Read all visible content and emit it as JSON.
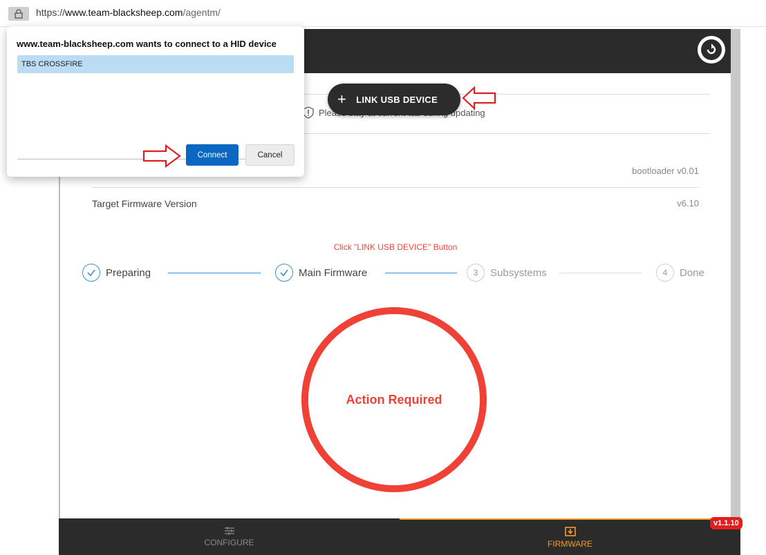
{
  "browser": {
    "url_prefix": "https://",
    "url_domain": "www.team-blacksheep.com",
    "url_path": "/agentm/"
  },
  "dialog": {
    "title": "www.team-blacksheep.com wants to connect to a HID device",
    "devices": [
      "TBS CROSSFIRE"
    ],
    "connect_label": "Connect",
    "cancel_label": "Cancel"
  },
  "link_button": {
    "label": "LINK USB DEVICE"
  },
  "notice": {
    "text": "Please stay at current tab during updating"
  },
  "firmware": {
    "current_value": "bootloader v0.01",
    "target_label": "Target Firmware Version",
    "target_value": "v6.10"
  },
  "hint": "Click \"LINK USB DEVICE\" Button",
  "steps": [
    {
      "num": "",
      "label": "Preparing",
      "state": "done"
    },
    {
      "num": "",
      "label": "Main Firmware",
      "state": "done"
    },
    {
      "num": "3",
      "label": "Subsystems",
      "state": "pending"
    },
    {
      "num": "4",
      "label": "Done",
      "state": "pending"
    }
  ],
  "status": {
    "text": "Action Required",
    "color": "#ef4136"
  },
  "nav": {
    "configure": "CONFIGURE",
    "firmware": "FIRMWARE",
    "active": "firmware"
  },
  "version": "v1.1.10",
  "colors": {
    "accent_blue": "#3a8ed6",
    "accent_orange": "#f59b20",
    "alert_red": "#ef4136",
    "dialog_primary": "#0a67c2"
  }
}
